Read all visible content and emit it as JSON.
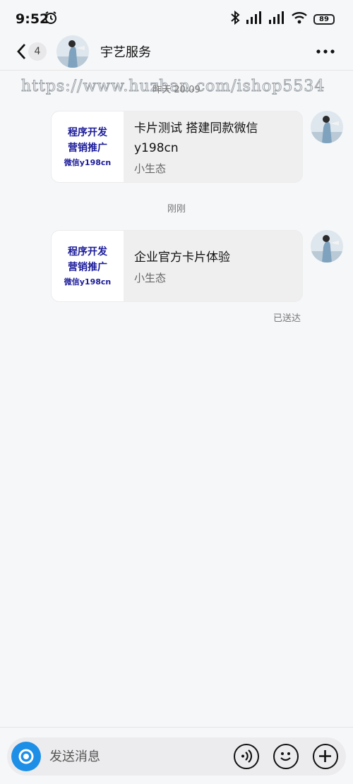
{
  "statusbar": {
    "time": "9:52",
    "battery": "89"
  },
  "header": {
    "back_count": "4",
    "title": "宇艺服务"
  },
  "watermark": "https://www.huzhan.com/ishop5534",
  "messages": [
    {
      "timestamp": "昨天 20:09",
      "card": {
        "thumb_line1": "程序开发",
        "thumb_line2": "营销推广",
        "thumb_line3": "微信y198cn",
        "title": "卡片测试 搭建同款微信y198cn",
        "source": "小生态"
      }
    },
    {
      "timestamp": "刚刚",
      "card": {
        "thumb_line1": "程序开发",
        "thumb_line2": "营销推广",
        "thumb_line3": "微信y198cn",
        "title": "企业官方卡片体验",
        "source": "小生态"
      },
      "status": "已送达"
    }
  ],
  "input": {
    "placeholder": "发送消息"
  },
  "colors": {
    "accent": "#1e8fe6",
    "thumb_text": "#1a1a9a"
  },
  "icons": [
    "alarm-icon",
    "bluetooth-icon",
    "signal-icon",
    "wifi-icon",
    "battery-icon",
    "back-icon",
    "more-icon",
    "camera-icon",
    "voice-icon",
    "emoji-icon",
    "plus-icon"
  ]
}
